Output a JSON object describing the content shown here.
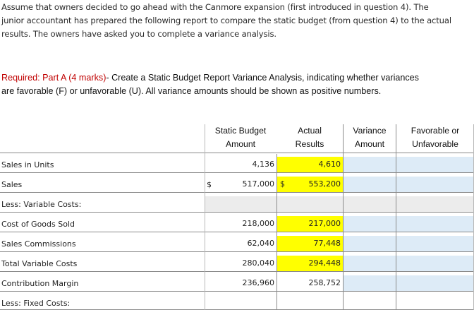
{
  "intro": {
    "line1": "Assume that owners decided to go ahead with the Canmore expansion (first introduced in question 4).  The",
    "line2": "junior accountant has prepared the following report to compare the static budget (from question 4) to the actual",
    "line3": "results.  The owners have asked you to complete a variance analysis."
  },
  "required": {
    "prefix": "Required: Part A (4 marks)",
    "line1_rest": "- Create a Static Budget Report Variance Analysis, indicating whether variances",
    "line2": "are favorable (F) or unfavorable (U).  All variance amounts should be shown as positive numbers."
  },
  "headers": {
    "static_l1": "Static Budget",
    "static_l2": "Amount",
    "actual_l1": "Actual",
    "actual_l2": "Results",
    "variance_l1": "Variance",
    "variance_l2": "Amount",
    "fav_l1": "Favorable or",
    "fav_l2": "Unfavorable"
  },
  "rows": {
    "sales_units": {
      "label": "Sales in Units",
      "static": "4,136",
      "actual": "4,610"
    },
    "sales": {
      "label": "Sales",
      "static_sym": "$",
      "static": "517,000",
      "actual_sym": "$",
      "actual": "553,200"
    },
    "less_var": {
      "label": "Less: Variable Costs:"
    },
    "cogs": {
      "label": "Cost of Goods Sold",
      "static": "218,000",
      "actual": "217,000"
    },
    "commissions": {
      "label": "Sales Commissions",
      "static": "62,040",
      "actual": "77,448"
    },
    "total_var": {
      "label": "Total Variable Costs",
      "static": "280,040",
      "actual": "294,448"
    },
    "contribution": {
      "label": "Contribution Margin",
      "static": "236,960",
      "actual": "258,752"
    },
    "less_fixed": {
      "label": "Less: Fixed Costs:"
    }
  },
  "colors": {
    "input_highlight": "#ffff00",
    "answer_cell": "#ddebf7",
    "required_text": "#c00000"
  }
}
